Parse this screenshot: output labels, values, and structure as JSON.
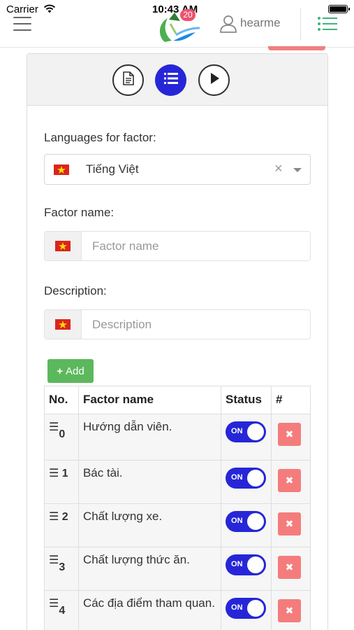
{
  "status_bar": {
    "carrier": "Carrier",
    "time": "10:43 AM"
  },
  "header": {
    "badge_count": "20",
    "username": "hearme",
    "icons": [
      "menu-icon",
      "app-logo",
      "user-icon",
      "list-menu-icon"
    ]
  },
  "toolbar": {
    "icons": [
      "document-icon",
      "list-icon",
      "play-icon"
    ],
    "active": "list-icon"
  },
  "form": {
    "languages_label": "Languages for factor:",
    "language_selected": "Tiếng Việt",
    "factor_name_label": "Factor name:",
    "factor_name_placeholder": "Factor name",
    "description_label": "Description:",
    "description_placeholder": "Description",
    "add_label": "Add"
  },
  "table": {
    "headers": {
      "no": "No.",
      "name": "Factor name",
      "status": "Status",
      "action": "#"
    },
    "rows": [
      {
        "no": "0",
        "name": "Hướng dẫn viên.",
        "status": "ON"
      },
      {
        "no": "1",
        "name": "Bác tài.",
        "status": "ON"
      },
      {
        "no": "2",
        "name": "Chất lượng xe.",
        "status": "ON"
      },
      {
        "no": "3",
        "name": "Chất lượng thức ăn.",
        "status": "ON"
      },
      {
        "no": "4",
        "name": "Các địa điểm tham quan.",
        "status": "ON"
      }
    ]
  },
  "colors": {
    "primary": "#2626d8",
    "success": "#5cb85c",
    "danger": "#f47c7c",
    "flag": "#da251d"
  }
}
